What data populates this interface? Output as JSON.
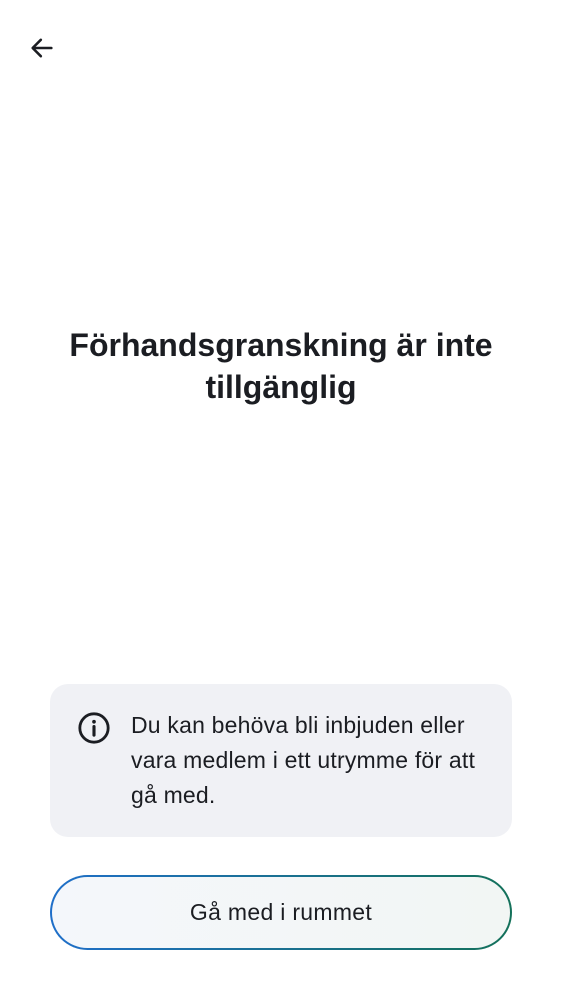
{
  "header": {
    "back_icon": "arrow-left-icon"
  },
  "main": {
    "title": "Förhandsgranskning är inte tillgänglig"
  },
  "info_card": {
    "icon": "info-circle-icon",
    "message": "Du kan behöva bli inbjuden eller vara medlem i ett utrymme för att gå med."
  },
  "actions": {
    "join_label": "Gå med i rummet"
  },
  "colors": {
    "text": "#1b1d22",
    "card_background": "#f0f1f5",
    "button_border_start": "#1f6fc9",
    "button_border_end": "#14715a"
  }
}
